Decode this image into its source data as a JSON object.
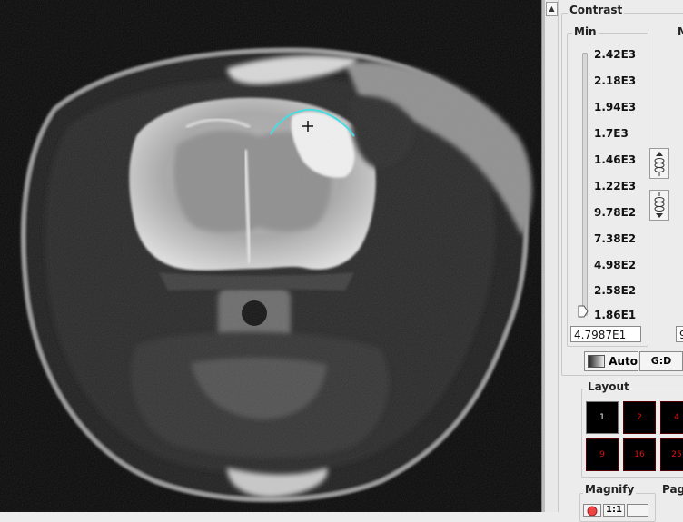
{
  "contrast": {
    "title": "Contrast",
    "min": {
      "label": "Min",
      "ticks": [
        "2.42E3",
        "2.18E3",
        "1.94E3",
        "1.7E3",
        "1.46E3",
        "1.22E3",
        "9.78E2",
        "7.38E2",
        "4.98E2",
        "2.58E2",
        "1.86E1"
      ],
      "value": "4.7987E1",
      "slider_position": 0.0
    },
    "max": {
      "label": "M",
      "value": "9"
    },
    "auto_label": "Auto",
    "swap_label": "G:D"
  },
  "layout": {
    "title": "Layout",
    "cells": [
      "1",
      "2",
      "4",
      "9",
      "16",
      "25"
    ],
    "active_index": 0
  },
  "magnify": {
    "title": "Magnify",
    "zoom_label": "1:1"
  },
  "page": {
    "title": "Pag"
  },
  "icons": {
    "scroll_up": "arrow-up-icon",
    "inc": "coil-up-icon",
    "dec": "coil-down-icon",
    "cursor": "crosshair-icon"
  },
  "colors": {
    "roi": "#39e0e8",
    "layout_text": "#d11111"
  }
}
